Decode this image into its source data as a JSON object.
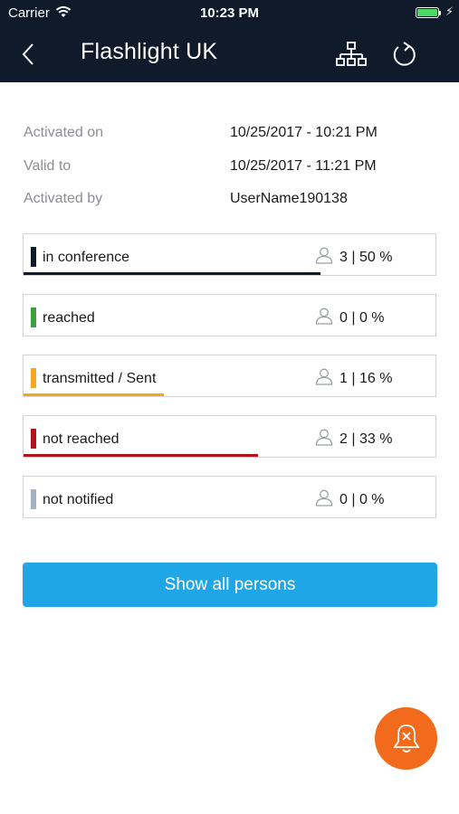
{
  "status_bar": {
    "carrier": "Carrier",
    "time": "10:23 PM"
  },
  "header": {
    "title": "Flashlight UK",
    "icons": [
      "back-chevron-icon",
      "hierarchy-icon",
      "refresh-icon"
    ]
  },
  "info": [
    {
      "label": "Activated on",
      "value": "10/25/2017 - 10:21 PM"
    },
    {
      "label": "Valid to",
      "value": "10/25/2017 - 11:21 PM"
    },
    {
      "label": "Activated by",
      "value": "UserName190138"
    }
  ],
  "statuses": [
    {
      "label": "in conference",
      "stat": "3 | 50 %",
      "color": "#0f1a2a",
      "fraction": 0.72
    },
    {
      "label": "reached",
      "stat": "0 | 0 %",
      "color": "#3da13a",
      "fraction": 0
    },
    {
      "label": "transmitted / Sent",
      "stat": "1 | 16 %",
      "color": "#f5a81f",
      "fraction": 0.34
    },
    {
      "label": "not reached",
      "stat": "2 | 33 %",
      "color": "#b0151d",
      "fraction": 0.57
    },
    {
      "label": "not notified",
      "stat": "0 | 0 %",
      "color": "#a3b1c2",
      "fraction": 0
    }
  ],
  "actions": {
    "show_all": "Show all persons"
  },
  "fab": {
    "icon": "bell-cancel-icon",
    "color": "#f26a1b"
  },
  "accent": "#1ea6e6"
}
